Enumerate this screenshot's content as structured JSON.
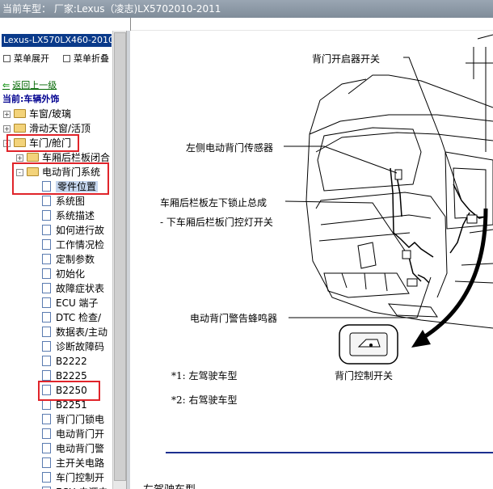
{
  "titlebar": {
    "text": "当前车型：  厂家:Lexus（凌志)LX5702010-2011"
  },
  "sidebar": {
    "model_selector": "Lexus-LX570LX460-2010",
    "expand_menu": "菜单展开",
    "collapse_menu": "菜单折叠",
    "back_link": "返回上一级",
    "current_label": "当前:车辆外饰",
    "tree": [
      {
        "label": "车窗/玻璃",
        "kind": "folder",
        "expander": "+"
      },
      {
        "label": "滑动天窗/活顶",
        "kind": "folder",
        "expander": "+"
      },
      {
        "label": "车门/舱门",
        "kind": "folder",
        "expander": "-"
      },
      {
        "label": "车厢后栏板闭合",
        "kind": "folder",
        "expander": "+"
      },
      {
        "label": "电动背门系统",
        "kind": "folder",
        "expander": "-"
      },
      {
        "label": "零件位置",
        "kind": "doc",
        "selected": true
      },
      {
        "label": "系统图",
        "kind": "doc"
      },
      {
        "label": "系统描述",
        "kind": "doc"
      },
      {
        "label": "如何进行故",
        "kind": "doc"
      },
      {
        "label": "工作情况检",
        "kind": "doc"
      },
      {
        "label": "定制参数",
        "kind": "doc"
      },
      {
        "label": "初始化",
        "kind": "doc"
      },
      {
        "label": "故障症状表",
        "kind": "doc"
      },
      {
        "label": "ECU 端子",
        "kind": "doc"
      },
      {
        "label": "DTC 检查/",
        "kind": "doc"
      },
      {
        "label": "数据表/主动",
        "kind": "doc"
      },
      {
        "label": "诊断故障码",
        "kind": "doc"
      },
      {
        "label": "B2222",
        "kind": "doc"
      },
      {
        "label": "B2225",
        "kind": "doc"
      },
      {
        "label": "B2250",
        "kind": "doc"
      },
      {
        "label": "B2251",
        "kind": "doc"
      },
      {
        "label": "背门门锁电",
        "kind": "doc"
      },
      {
        "label": "电动背门开",
        "kind": "doc"
      },
      {
        "label": "电动背门警",
        "kind": "doc"
      },
      {
        "label": "主开关电路",
        "kind": "doc"
      },
      {
        "label": "车门控制开",
        "kind": "doc"
      },
      {
        "label": "ECU 电源电",
        "kind": "doc"
      }
    ]
  },
  "diagram": {
    "labels": {
      "opener_switch": "背门开启器开关",
      "lh_sensor": "左侧电动背门传感器",
      "tailgate_lock": "车厢后栏板左下锁止总成",
      "courtesy_switch": "- 下车厢后栏板门控灯开关",
      "buzzer": "电动背门警告蜂鸣器",
      "control_switch": "背门控制开关"
    },
    "notes": [
      {
        "marker": "*1:",
        "text": "左驾驶车型"
      },
      {
        "marker": "*2:",
        "text": "右驾驶车型"
      }
    ],
    "footer_text": "左驾驶车型"
  }
}
